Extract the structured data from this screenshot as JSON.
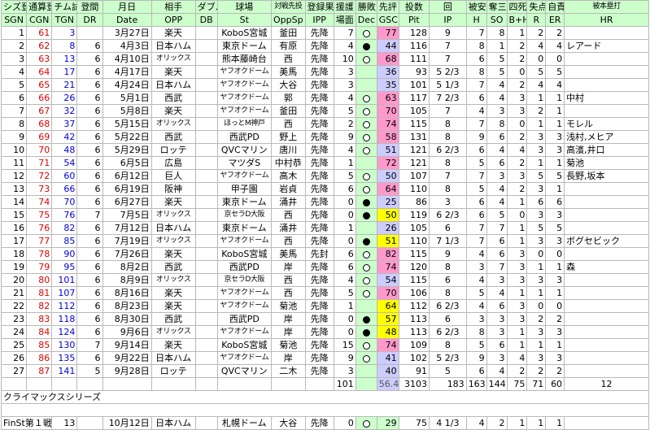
{
  "colors": {
    "header_bg": "#ccffcc",
    "cgn_red": "#e00000",
    "tgn_blue": "#0000dd",
    "gsc_pink": "#ff99cc",
    "gsc_yellow": "#ffff00",
    "gsc_lavender": "#ccccff"
  },
  "header": {
    "jp": [
      "シズ登",
      "通算登",
      "チム試",
      "登間",
      "月日",
      "相手",
      "ダブル",
      "球場",
      "対戦先投",
      "登録果",
      "援護",
      "勝敗",
      "先評",
      "投数",
      "回",
      "被安",
      "奪三",
      "四死",
      "失点",
      "自責",
      "被本塁打"
    ],
    "en": [
      "SGN",
      "CGN",
      "TGN",
      "DR",
      "Date",
      "OPP",
      "DB",
      "St",
      "OppSp",
      "IPP",
      "場面",
      "Dec",
      "GSC",
      "Pit",
      "IP",
      "H",
      "SO",
      "B+H",
      "R",
      "ER",
      "HR"
    ]
  },
  "rows": [
    {
      "sgn": "1",
      "cgn": "61",
      "tgn": "3",
      "dr": "",
      "date": "3月27日",
      "opp": "楽天",
      "db": "",
      "st": "KoboS宮城",
      "oppsp": "釜田",
      "ipp": "先降",
      "run": "7",
      "dec": "win",
      "gsc": "77",
      "gsc_color": "pink",
      "pit": "128",
      "ip": "9",
      "h": "7",
      "so": "8",
      "bh": "1",
      "r": "2",
      "er": "2",
      "hr": ""
    },
    {
      "sgn": "2",
      "cgn": "62",
      "tgn": "8",
      "dr": "6",
      "date": "4月3日",
      "opp": "日本ハム",
      "db": "",
      "st": "東京ドーム",
      "oppsp": "有原",
      "ipp": "先降",
      "run": "4",
      "dec": "loss",
      "gsc": "44",
      "gsc_color": "blue",
      "pit": "116",
      "ip": "7",
      "h": "8",
      "so": "1",
      "bh": "2",
      "r": "4",
      "er": "4",
      "hr": "レアード"
    },
    {
      "sgn": "3",
      "cgn": "63",
      "tgn": "13",
      "dr": "6",
      "date": "4月10日",
      "opp": "オリックス",
      "db": "",
      "st": "熊本藤崎台",
      "oppsp": "西",
      "ipp": "先降",
      "run": "10",
      "dec": "win",
      "gsc": "68",
      "gsc_color": "pink",
      "pit": "111",
      "ip": "7",
      "h": "6",
      "so": "5",
      "bh": "2",
      "r": "0",
      "er": "0",
      "hr": ""
    },
    {
      "sgn": "4",
      "cgn": "64",
      "tgn": "17",
      "dr": "6",
      "date": "4月17日",
      "opp": "楽天",
      "db": "",
      "st": "ヤフオクドーム",
      "oppsp": "美馬",
      "ipp": "先降",
      "run": "3",
      "dec": "",
      "gsc": "36",
      "gsc_color": "blue",
      "pit": "93",
      "ip": "5 2/3",
      "h": "8",
      "so": "5",
      "bh": "0",
      "r": "5",
      "er": "5",
      "hr": ""
    },
    {
      "sgn": "5",
      "cgn": "65",
      "tgn": "21",
      "dr": "6",
      "date": "4月24日",
      "opp": "日本ハム",
      "db": "",
      "st": "ヤフオクドーム",
      "oppsp": "大谷",
      "ipp": "先降",
      "run": "3",
      "dec": "",
      "gsc": "35",
      "gsc_color": "blue",
      "pit": "101",
      "ip": "5 1/3",
      "h": "7",
      "so": "4",
      "bh": "2",
      "r": "4",
      "er": "4",
      "hr": ""
    },
    {
      "sgn": "6",
      "cgn": "66",
      "tgn": "26",
      "dr": "6",
      "date": "5月1日",
      "opp": "西武",
      "db": "",
      "st": "ヤフオクドーム",
      "oppsp": "郭",
      "ipp": "先降",
      "run": "4",
      "dec": "win",
      "gsc": "63",
      "gsc_color": "pink",
      "pit": "117",
      "ip": "7 2/3",
      "h": "6",
      "so": "4",
      "bh": "3",
      "r": "1",
      "er": "1",
      "hr": "中村"
    },
    {
      "sgn": "7",
      "cgn": "67",
      "tgn": "32",
      "dr": "6",
      "date": "5月8日",
      "opp": "楽天",
      "db": "",
      "st": "ヤフオクドーム",
      "oppsp": "釜田",
      "ipp": "先降",
      "run": "5",
      "dec": "win",
      "gsc": "70",
      "gsc_color": "pink",
      "pit": "105",
      "ip": "7",
      "h": "4",
      "so": "3",
      "bh": "3",
      "r": "2",
      "er": "1",
      "hr": ""
    },
    {
      "sgn": "8",
      "cgn": "68",
      "tgn": "37",
      "dr": "6",
      "date": "5月15日",
      "opp": "オリックス",
      "db": "",
      "st": "ほっとM神戸",
      "oppsp": "西",
      "ipp": "先降",
      "run": "2",
      "dec": "win",
      "gsc": "74",
      "gsc_color": "pink",
      "pit": "115",
      "ip": "8",
      "h": "7",
      "so": "8",
      "bh": "0",
      "r": "1",
      "er": "1",
      "hr": "モレル"
    },
    {
      "sgn": "9",
      "cgn": "69",
      "tgn": "42",
      "dr": "6",
      "date": "5月22日",
      "opp": "西武",
      "db": "",
      "st": "西武PD",
      "oppsp": "野上",
      "ipp": "先降",
      "run": "9",
      "dec": "win",
      "gsc": "58",
      "gsc_color": "pink",
      "pit": "131",
      "ip": "8",
      "h": "9",
      "so": "6",
      "bh": "2",
      "r": "3",
      "er": "3",
      "hr": "浅村,メヒア"
    },
    {
      "sgn": "10",
      "cgn": "70",
      "tgn": "48",
      "dr": "6",
      "date": "5月29日",
      "opp": "ロッテ",
      "db": "",
      "st": "QVCマリン",
      "oppsp": "唐川",
      "ipp": "先降",
      "run": "4",
      "dec": "win",
      "gsc": "51",
      "gsc_color": "blue",
      "pit": "121",
      "ip": "6 2/3",
      "h": "6",
      "so": "4",
      "bh": "4",
      "r": "3",
      "er": "3",
      "hr": "高濱,井口"
    },
    {
      "sgn": "11",
      "cgn": "71",
      "tgn": "54",
      "dr": "6",
      "date": "6月5日",
      "opp": "広島",
      "db": "",
      "st": "マツダS",
      "oppsp": "中村恭",
      "ipp": "先降",
      "run": "1",
      "dec": "",
      "gsc": "72",
      "gsc_color": "pink",
      "pit": "121",
      "ip": "8",
      "h": "5",
      "so": "6",
      "bh": "2",
      "r": "1",
      "er": "1",
      "hr": "菊池"
    },
    {
      "sgn": "12",
      "cgn": "72",
      "tgn": "60",
      "dr": "6",
      "date": "6月12日",
      "opp": "巨人",
      "db": "",
      "st": "ヤフオクドーム",
      "oppsp": "高木",
      "ipp": "先降",
      "run": "5",
      "dec": "win",
      "gsc": "50",
      "gsc_color": "blue",
      "pit": "107",
      "ip": "7",
      "h": "7",
      "so": "3",
      "bh": "3",
      "r": "5",
      "er": "5",
      "hr": "長野,坂本"
    },
    {
      "sgn": "13",
      "cgn": "73",
      "tgn": "66",
      "dr": "6",
      "date": "6月19日",
      "opp": "阪神",
      "db": "",
      "st": "甲子園",
      "oppsp": "岩貞",
      "ipp": "先降",
      "run": "6",
      "dec": "win",
      "gsc": "64",
      "gsc_color": "pink",
      "pit": "110",
      "ip": "8",
      "h": "5",
      "so": "4",
      "bh": "2",
      "r": "3",
      "er": "1",
      "hr": ""
    },
    {
      "sgn": "14",
      "cgn": "74",
      "tgn": "70",
      "dr": "6",
      "date": "6月27日",
      "opp": "楽天",
      "db": "",
      "st": "東京ドーム",
      "oppsp": "涌井",
      "ipp": "先降",
      "run": "0",
      "dec": "loss",
      "gsc": "25",
      "gsc_color": "blue",
      "pit": "86",
      "ip": "3",
      "h": "6",
      "so": "4",
      "bh": "1",
      "r": "6",
      "er": "6",
      "hr": ""
    },
    {
      "sgn": "15",
      "cgn": "75",
      "tgn": "76",
      "dr": "7",
      "date": "7月5日",
      "opp": "オリックス",
      "db": "",
      "st": "京セラD大阪",
      "oppsp": "西",
      "ipp": "先降",
      "run": "0",
      "dec": "loss",
      "gsc": "50",
      "gsc_color": "yellow",
      "pit": "119",
      "ip": "6 2/3",
      "h": "6",
      "so": "5",
      "bh": "0",
      "r": "3",
      "er": "3",
      "hr": ""
    },
    {
      "sgn": "16",
      "cgn": "76",
      "tgn": "82",
      "dr": "6",
      "date": "7月12日",
      "opp": "日本ハム",
      "db": "",
      "st": "東京ドーム",
      "oppsp": "涌井",
      "ipp": "先降",
      "run": "1",
      "dec": "",
      "gsc": "26",
      "gsc_color": "blue",
      "pit": "105",
      "ip": "6",
      "h": "7",
      "so": "7",
      "bh": "1",
      "r": "5",
      "er": "5",
      "hr": ""
    },
    {
      "sgn": "17",
      "cgn": "77",
      "tgn": "85",
      "dr": "6",
      "date": "7月19日",
      "opp": "オリックス",
      "db": "",
      "st": "ヤフオクドーム",
      "oppsp": "西",
      "ipp": "先降",
      "run": "0",
      "dec": "loss",
      "gsc": "51",
      "gsc_color": "yellow",
      "pit": "110",
      "ip": "7 1/3",
      "h": "7",
      "so": "6",
      "bh": "1",
      "r": "3",
      "er": "3",
      "hr": "ボグセビック"
    },
    {
      "sgn": "18",
      "cgn": "78",
      "tgn": "90",
      "dr": "6",
      "date": "7月26日",
      "opp": "楽天",
      "db": "",
      "st": "KoboS宮城",
      "oppsp": "美馬",
      "ipp": "先封",
      "run": "6",
      "dec": "win",
      "gsc": "82",
      "gsc_color": "pink",
      "pit": "115",
      "ip": "9",
      "h": "4",
      "so": "6",
      "bh": "3",
      "r": "0",
      "er": "0",
      "hr": ""
    },
    {
      "sgn": "19",
      "cgn": "79",
      "tgn": "95",
      "dr": "6",
      "date": "8月2日",
      "opp": "西武",
      "db": "",
      "st": "西武PD",
      "oppsp": "岸",
      "ipp": "先降",
      "run": "6",
      "dec": "win",
      "gsc": "74",
      "gsc_color": "pink",
      "pit": "120",
      "ip": "8",
      "h": "3",
      "so": "7",
      "bh": "3",
      "r": "1",
      "er": "1",
      "hr": "森"
    },
    {
      "sgn": "20",
      "cgn": "80",
      "tgn": "101",
      "dr": "6",
      "date": "8月9日",
      "opp": "オリックス",
      "db": "",
      "st": "京セラD大阪",
      "oppsp": "西",
      "ipp": "先降",
      "run": "4",
      "dec": "win",
      "gsc": "54",
      "gsc_color": "blue",
      "pit": "115",
      "ip": "6",
      "h": "4",
      "so": "3",
      "bh": "3",
      "r": "3",
      "er": "3",
      "hr": ""
    },
    {
      "sgn": "21",
      "cgn": "81",
      "tgn": "107",
      "dr": "6",
      "date": "8月16日",
      "opp": "楽天",
      "db": "",
      "st": "ヤフオクドーム",
      "oppsp": "西",
      "ipp": "先降",
      "run": "5",
      "dec": "win",
      "gsc": "70",
      "gsc_color": "pink",
      "pit": "106",
      "ip": "8",
      "h": "5",
      "so": "4",
      "bh": "1",
      "r": "1",
      "er": "1",
      "hr": ""
    },
    {
      "sgn": "22",
      "cgn": "82",
      "tgn": "112",
      "dr": "6",
      "date": "8月23日",
      "opp": "楽天",
      "db": "",
      "st": "ヤフオクドーム",
      "oppsp": "菊池",
      "ipp": "先降",
      "run": "1",
      "dec": "",
      "gsc": "64",
      "gsc_color": "yellow",
      "pit": "112",
      "ip": "6 2/3",
      "h": "4",
      "so": "6",
      "bh": "3",
      "r": "0",
      "er": "0",
      "hr": ""
    },
    {
      "sgn": "23",
      "cgn": "83",
      "tgn": "118",
      "dr": "6",
      "date": "8月30日",
      "opp": "西武",
      "db": "",
      "st": "西武PD",
      "oppsp": "岸",
      "ipp": "先降",
      "run": "0",
      "dec": "loss",
      "gsc": "57",
      "gsc_color": "yellow",
      "pit": "113",
      "ip": "6",
      "h": "3",
      "so": "3",
      "bh": "3",
      "r": "2",
      "er": "2",
      "hr": ""
    },
    {
      "sgn": "24",
      "cgn": "84",
      "tgn": "124",
      "dr": "6",
      "date": "9月6日",
      "opp": "オリックス",
      "db": "",
      "st": "ヤフオクドーム",
      "oppsp": "岸",
      "ipp": "先降",
      "run": "0",
      "dec": "loss",
      "gsc": "48",
      "gsc_color": "yellow",
      "pit": "113",
      "ip": "6 2/3",
      "h": "8",
      "so": "3",
      "bh": "1",
      "r": "3",
      "er": "3",
      "hr": ""
    },
    {
      "sgn": "25",
      "cgn": "85",
      "tgn": "130",
      "dr": "7",
      "date": "9月14日",
      "opp": "楽天",
      "db": "",
      "st": "KoboS宮城",
      "oppsp": "菊池",
      "ipp": "先降",
      "run": "15",
      "dec": "win",
      "gsc": "74",
      "gsc_color": "pink",
      "pit": "109",
      "ip": "8",
      "h": "5",
      "so": "6",
      "bh": "1",
      "r": "1",
      "er": "1",
      "hr": ""
    },
    {
      "sgn": "26",
      "cgn": "86",
      "tgn": "135",
      "dr": "6",
      "date": "9月22日",
      "opp": "日本ハム",
      "db": "",
      "st": "ヤフオクドーム",
      "oppsp": "岸",
      "ipp": "先降",
      "run": "9",
      "dec": "win",
      "gsc": "41",
      "gsc_color": "blue",
      "pit": "102",
      "ip": "5 2/3",
      "h": "9",
      "so": "3",
      "bh": "4",
      "r": "3",
      "er": "3",
      "hr": ""
    },
    {
      "sgn": "27",
      "cgn": "87",
      "tgn": "141",
      "dr": "5",
      "date": "9月28日",
      "opp": "ロッテ",
      "db": "",
      "st": "QVCマリン",
      "oppsp": "二木",
      "ipp": "先降",
      "run": "3",
      "dec": "",
      "gsc": "40",
      "gsc_color": "blue",
      "pit": "91",
      "ip": "5",
      "h": "6",
      "so": "4",
      "bh": "2",
      "r": "2",
      "er": "2",
      "hr": ""
    }
  ],
  "totals": {
    "run": "101",
    "gsc": "56.4",
    "pit": "3103",
    "ip": "183",
    "h": "163",
    "so": "144",
    "bh": "75",
    "r": "71",
    "er": "60",
    "hr": "12"
  },
  "section_title": "クライマックスシリーズ",
  "cs_row": {
    "label": "FinSt第１戦",
    "tgn": "13",
    "date": "10月12日",
    "opp": "日本ハム",
    "st": "札幌ドーム",
    "oppsp": "大谷",
    "ipp": "先降",
    "run": "0",
    "dec": "win",
    "gsc": "29",
    "gsc_color": "green",
    "pit": "75",
    "ip": "4 1/3",
    "h": "4",
    "so": "2",
    "bh": "1",
    "r": "1",
    "er": "1",
    "hr": ""
  }
}
